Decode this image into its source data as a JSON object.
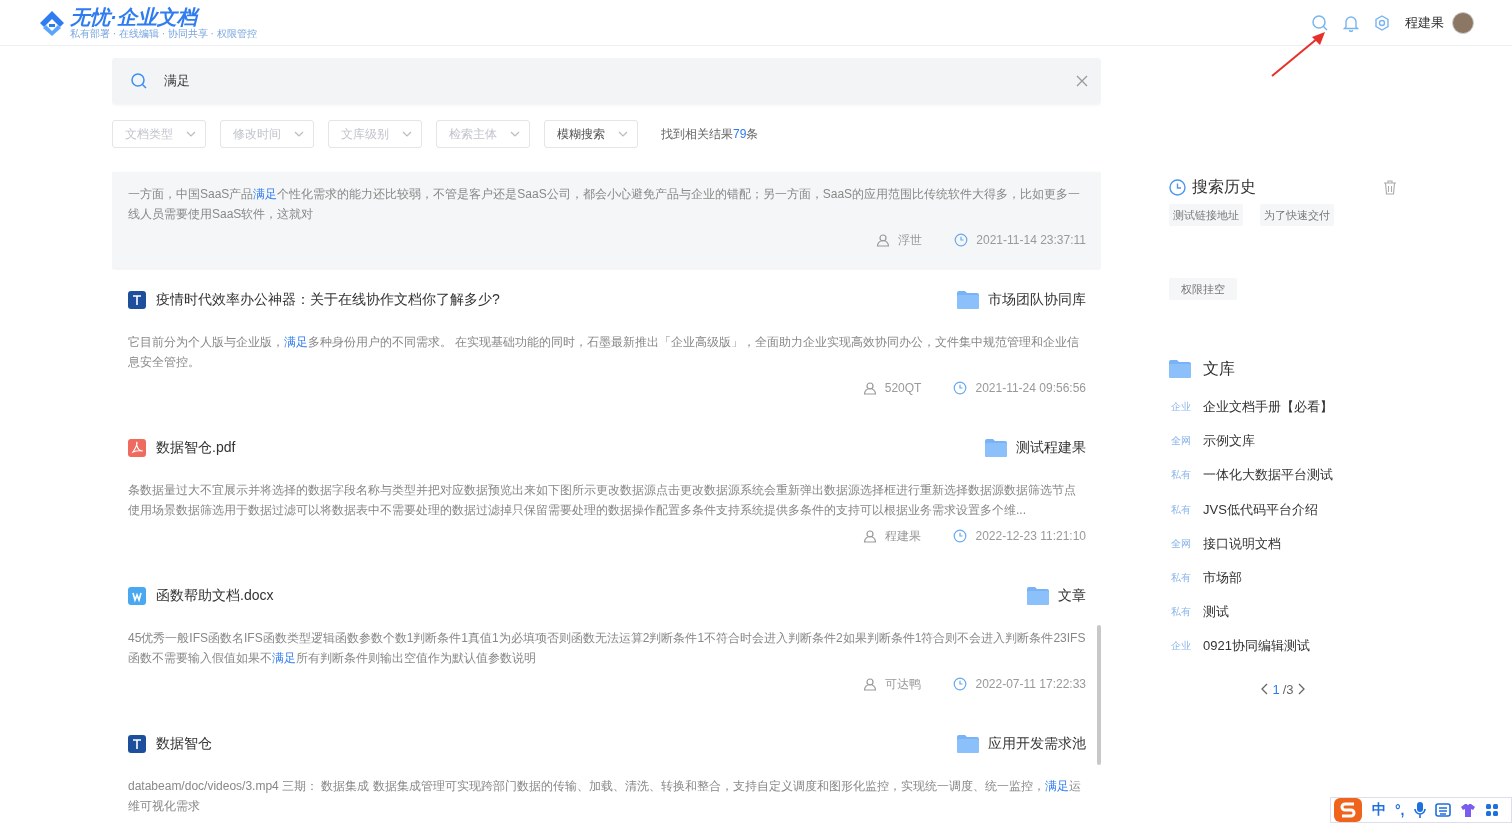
{
  "header": {
    "logo_title": "无忧·企业文档",
    "logo_subtitle": "私有部署 · 在线编辑 · 协同共享 · 权限管控",
    "user_name": "程建果"
  },
  "search": {
    "value": "满足"
  },
  "filters": [
    {
      "placeholder": "文档类型"
    },
    {
      "placeholder": "修改时间"
    },
    {
      "placeholder": "文库级别"
    },
    {
      "placeholder": "检索主体"
    },
    {
      "value": "模糊搜索"
    }
  ],
  "result_count": {
    "prefix": "找到相关结果",
    "count": "79",
    "suffix": "条"
  },
  "results": [
    {
      "hovered": true,
      "snippet": [
        {
          "text": "一方面，中国SaaS产品",
          "match": false
        },
        {
          "text": "满足",
          "match": true
        },
        {
          "text": "个性化需求的能力还比较弱，不管是客户还是SaaS公司，都会小心避免产品与企业的错配；另一方面，SaaS的应用范围比传统软件大得多，比如更多一线人员需要使用SaaS软件，这就对",
          "match": false
        }
      ],
      "author": "浮世",
      "time": "2021-11-14 23:37:11"
    },
    {
      "hovered": false,
      "kind": "doc",
      "title": "疫情时代效率办公神器：关于在线协作文档你了解多少?",
      "library": "市场团队协同库",
      "snippet": [
        {
          "text": "它目前分为个人版与企业版，",
          "match": false
        },
        {
          "text": "满足",
          "match": true
        },
        {
          "text": "多种身份用户的不同需求。 在实现基础功能的同时，石墨最新推出「企业高级版」，全面助力企业实现高效协同办公，文件集中规范管理和企业信息安全管控。",
          "match": false
        }
      ],
      "author": "520QT",
      "time": "2021-11-24 09:56:56"
    },
    {
      "hovered": false,
      "kind": "pdf",
      "title": "数据智仓.pdf",
      "library": "测试程建果",
      "snippet": [
        {
          "text": "条数据量过大不宜展示并将选择的数据字段名称与类型并把对应数据预览出来如下图所示更改数据源点击更改数据源系统会重新弹出数据源选择框进行重新选择数据源数据筛选节点使用场景数据筛选用于数据过滤可以将数据表中不需要处理的数据过滤掉只保留需要处理的数据操作配置多条件支持系统提供多条件的支持可以根据业务需求设置多个维...",
          "match": false
        }
      ],
      "author": "程建果",
      "time": "2022-12-23 11:21:10"
    },
    {
      "hovered": false,
      "kind": "word",
      "title": "函数帮助文档.docx",
      "library": "文章",
      "snippet": [
        {
          "text": "45优秀一般IFS函数名IFS函数类型逻辑函数参数个数1判断条件1真值1为必填项否则函数无法运算2判断条件1不符合时会进入判断条件2如果判断条件1符合则不会进入判断条件23IFS函数不需要输入假值如果不",
          "match": false
        },
        {
          "text": "满足",
          "match": true
        },
        {
          "text": "所有判断条件则输出空值作为默认值参数说明",
          "match": false
        }
      ],
      "author": "可达鸭",
      "time": "2022-07-11 17:22:33"
    },
    {
      "hovered": false,
      "kind": "doc",
      "title": "数据智仓",
      "library": "应用开发需求池",
      "snippet": [
        {
          "text": "databeam/doc/videos/3.mp4 三期： 数据集成 数据集成管理可实现跨部门数据的传输、加载、清洗、转换和整合，支持自定义调度和图形化监控，实现统一调度、统一监控，",
          "match": false
        },
        {
          "text": "满足",
          "match": true
        },
        {
          "text": "运维可视化需求",
          "match": false
        }
      ]
    }
  ],
  "history": {
    "title": "搜索历史",
    "tags": [
      "测试链接地址",
      "为了快速交付",
      "权限挂空"
    ]
  },
  "library": {
    "title": "文库",
    "items": [
      {
        "scope": "企业",
        "name": "企业文档手册【必看】"
      },
      {
        "scope": "全网",
        "name": "示例文库"
      },
      {
        "scope": "私有",
        "name": "一体化大数据平台测试"
      },
      {
        "scope": "私有",
        "name": "JVS低代码平台介绍"
      },
      {
        "scope": "全网",
        "name": "接口说明文档"
      },
      {
        "scope": "私有",
        "name": "市场部"
      },
      {
        "scope": "私有",
        "name": "测试"
      },
      {
        "scope": "企业",
        "name": "0921协同编辑测试"
      }
    ],
    "pagination": {
      "current": "1",
      "separator": "/",
      "total": "3"
    }
  },
  "ime_bar": {
    "mode": "中",
    "punctuation": "°,"
  }
}
